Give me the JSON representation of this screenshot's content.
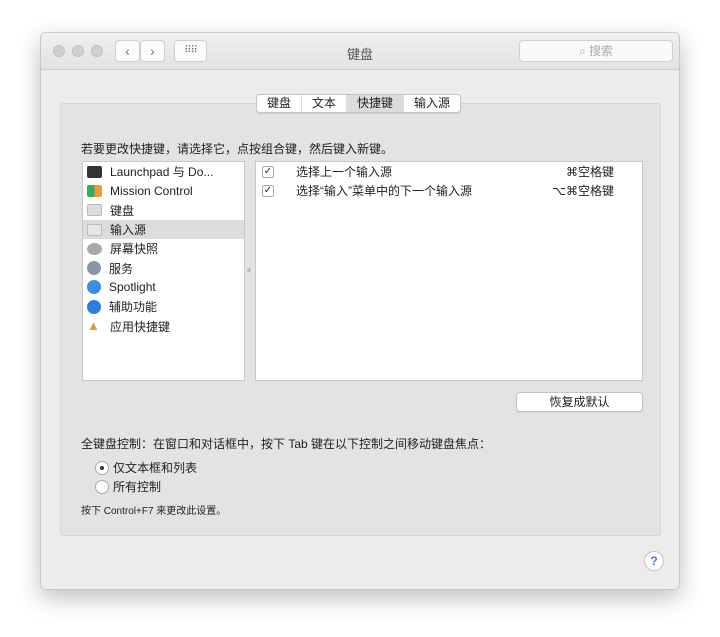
{
  "window": {
    "title": "键盘",
    "search_placeholder": "搜索"
  },
  "tabs": [
    {
      "label": "键盘"
    },
    {
      "label": "文本"
    },
    {
      "label": "快捷键",
      "active": true
    },
    {
      "label": "输入源"
    }
  ],
  "instruction": "若要更改快捷键，请选择它，点按组合键，然后键入新键。",
  "categories": [
    {
      "label": "Launchpad 与 Do...",
      "icon": "launchpad-icon",
      "color": "#333333"
    },
    {
      "label": "Mission Control",
      "icon": "mission-control-icon",
      "color": "#2f4a2f"
    },
    {
      "label": "键盘",
      "icon": "keyboard-icon",
      "color": "#d8d8d8"
    },
    {
      "label": "输入源",
      "icon": "input-source-icon",
      "color": "#d8d8d8",
      "selected": true
    },
    {
      "label": "屏幕快照",
      "icon": "screenshot-icon",
      "color": "#9a9a9a"
    },
    {
      "label": "服务",
      "icon": "gear-icon",
      "color": "#8a95a5"
    },
    {
      "label": "Spotlight",
      "icon": "spotlight-icon",
      "color": "#3b8ee0"
    },
    {
      "label": "辅助功能",
      "icon": "accessibility-icon",
      "color": "#2a7ee0"
    },
    {
      "label": "应用快捷键",
      "icon": "app-shortcuts-icon",
      "color": "#e0a030"
    }
  ],
  "shortcuts": [
    {
      "checked": true,
      "label": "选择上一个输入源",
      "keys": "⌘空格键"
    },
    {
      "checked": true,
      "label": "选择“输入”菜单中的下一个输入源",
      "keys": "⌥⌘空格键"
    }
  ],
  "restore_label": "恢复成默认",
  "full_keyboard_label": "全键盘控制：在窗口和对话框中，按下 Tab 键在以下控制之间移动键盘焦点：",
  "radio_options": [
    {
      "label": "仅文本框和列表",
      "selected": true
    },
    {
      "label": "所有控制",
      "selected": false
    }
  ],
  "note": "按下 Control+F7 来更改此设置。",
  "help_label": "?"
}
